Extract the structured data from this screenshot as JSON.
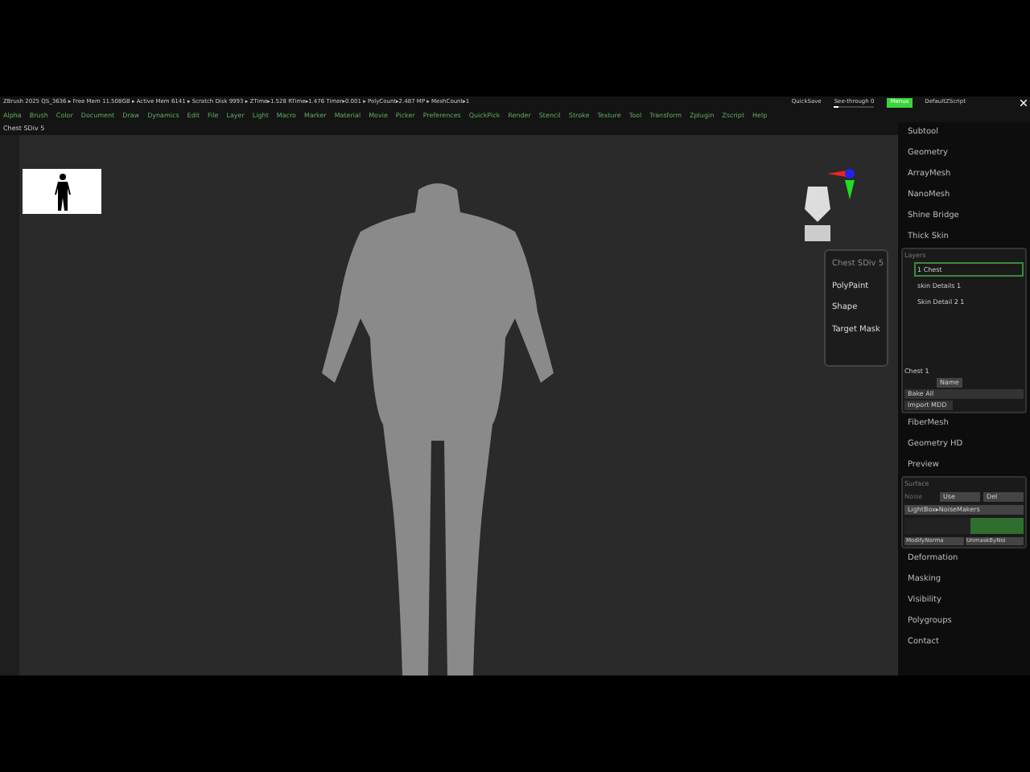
{
  "title_bar": {
    "status": "ZBrush 2025   QS_3636   ▸ Free Mem 11.508GB ▸ Active Mem 6141 ▸ Scratch Disk 9993 ▸ ZTime▸1.528 RTime▸1.476 Timer▸0.001 ▸ PolyCount▸2.487 MP ▸ MeshCount▸1",
    "quicksave": "QuickSave",
    "see_through": {
      "label": "See-through  0",
      "level": 0.1
    },
    "menus_button": {
      "label": "Menus",
      "on": true
    },
    "script": "DefaultZScript"
  },
  "menu_bar": [
    "Alpha",
    "Brush",
    "Color",
    "Document",
    "Draw",
    "Dynamics",
    "Edit",
    "File",
    "Layer",
    "Light",
    "Macro",
    "Marker",
    "Material",
    "Movie",
    "Picker",
    "Preferences",
    "QuickPick",
    "Render",
    "Stencil",
    "Stroke",
    "Texture",
    "Tool",
    "Transform",
    "Zplugin",
    "Zscript",
    "Help"
  ],
  "document_title": "Chest SDiv 5",
  "popup_menu": {
    "header": "Chest SDiv 5",
    "items": [
      "PolyPaint",
      "Shape",
      "Target Mask"
    ]
  },
  "right_panel": {
    "top_items": [
      "Subtool",
      "Geometry",
      "ArrayMesh",
      "NanoMesh",
      "Shine Bridge",
      "Thick Skin"
    ],
    "layers": {
      "title": "Layers",
      "rows": [
        {
          "name": "1 Chest",
          "selected": true
        },
        {
          "name": "skin Details 1",
          "selected": false
        },
        {
          "name": "Skin Detail 2 1",
          "selected": false
        }
      ],
      "current": "Chest 1",
      "name_button": "Name",
      "bake_button": "Bake All",
      "import_button": "Import MDD"
    },
    "middle_items": [
      "FiberMesh",
      "Geometry HD",
      "Preview"
    ],
    "surface": {
      "title": "Surface",
      "noise_label": "Noise",
      "buttons": [
        "Use",
        "Del"
      ],
      "lightbox": "LightBox▸NoiseMakers",
      "noise_slider": {
        "level": 0.45
      },
      "bottom_buttons": [
        "ModifyNorma",
        "UnmaskByNoi"
      ]
    },
    "bottom_items": [
      "Deformation",
      "Masking",
      "Visibility",
      "Polygroups",
      "Contact"
    ]
  }
}
